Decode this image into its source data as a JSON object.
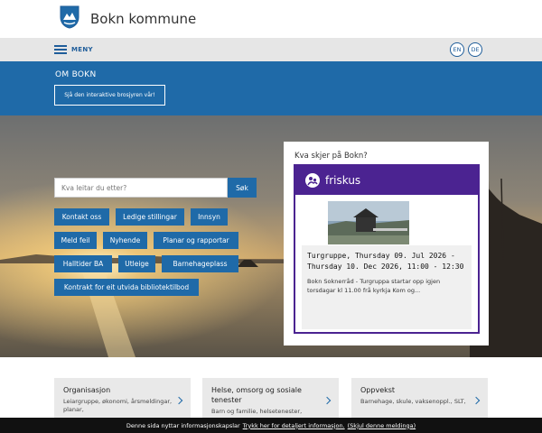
{
  "header": {
    "site_title": "Bokn kommune",
    "logo_icon": "coat-of-arms-icon"
  },
  "menubar": {
    "menu_label": "MENY",
    "languages": [
      "EN",
      "DE"
    ]
  },
  "about": {
    "title": "OM BOKN",
    "brochure_button": "Sjå den interaktive brosjyren vår!"
  },
  "search": {
    "placeholder": "Kva leitar du etter?",
    "button_label": "Søk"
  },
  "quick_links": [
    "Kontakt oss",
    "Ledige stillingar",
    "Innsyn",
    "Meld feil",
    "Nyhende",
    "Planar og rapportar",
    "Halltider BA",
    "Utleige",
    "Barnehageplass",
    "Kontrakt for eit utvida bibliotektilbod"
  ],
  "events": {
    "heading": "Kva skjer på Bokn?",
    "provider": "friskus",
    "item": {
      "title": "Turgruppe, Thursday 09. Jul 2026 - Thursday 10. Dec 2026, 11:00 - 12:30",
      "description": "Bokn Soknerråd - Turgruppa startar opp igjen torsdagar kl 11.00 frå kyrkja Kom og..."
    }
  },
  "cards": [
    {
      "title": "Organisasjon",
      "text": "Leiargruppe, økonomi, årsmeldingar, planar,"
    },
    {
      "title": "Helse, omsorg og sosiale tenester",
      "text": "Barn og familie, helsetenester,"
    },
    {
      "title": "Oppvekst",
      "text": "Barnehage, skule, vaksenoppl., SLT,"
    }
  ],
  "cookie": {
    "text": "Denne sida nyttar informasjonskapslar",
    "link_more": "Trykk her for detaljert informasjon.",
    "link_hide": "(Skjul denne meldinga)"
  },
  "colors": {
    "primary_blue": "#1f6aa8",
    "friskus_purple": "#4b2391",
    "menubar_gray": "#e6e6e6"
  }
}
